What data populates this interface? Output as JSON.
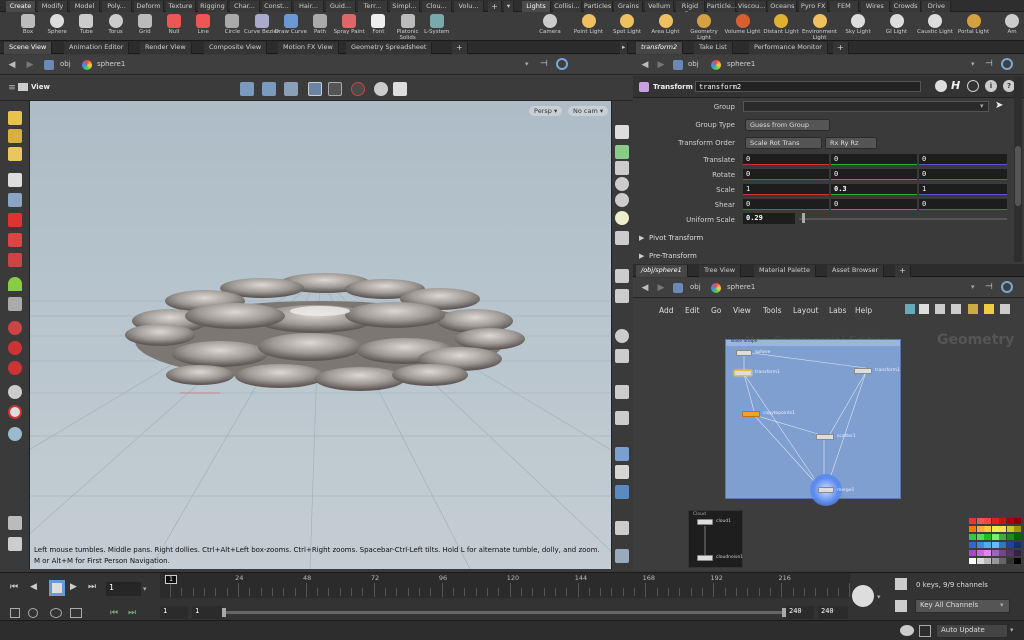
{
  "shelf_tabs_left": [
    "Create",
    "Modify",
    "Model",
    "Poly...",
    "Deform",
    "Texture",
    "Rigging",
    "Char...",
    "Const...",
    "Hair...",
    "Guid...",
    "Terr...",
    "Simpl...",
    "Clou...",
    "Volu..."
  ],
  "shelf_tabs_right": [
    "Lights a...",
    "Collisi...",
    "Particles",
    "Grains",
    "Vellum",
    "Rigid B...",
    "Particle...",
    "Viscou...",
    "Oceans",
    "Pyro FX",
    "FEM",
    "Wires",
    "Crowds",
    "Drive S..."
  ],
  "shelf_tools_left": [
    "Box",
    "Sphere",
    "Tube",
    "Torus",
    "Grid",
    "Null",
    "Line",
    "Circle",
    "Curve Bezier",
    "Draw Curve",
    "Path",
    "Spray Paint",
    "Font",
    "Platonic Solids",
    "L-System"
  ],
  "shelf_tools_right": [
    "Camera",
    "Point Light",
    "Spot Light",
    "Area Light",
    "Geometry Light",
    "Volume Light",
    "Distant Light",
    "Environment Light",
    "Sky Light",
    "GI Light",
    "Caustic Light",
    "Portal Light",
    "Am"
  ],
  "left_pane_tabs": [
    "Scene View",
    "Animation Editor",
    "Render View",
    "Composite View",
    "Motion FX View",
    "Geometry Spreadsheet"
  ],
  "right_top_tabs": [
    "transform2",
    "Take List",
    "Performance Monitor"
  ],
  "right_bottom_tabs": [
    "/obj/sphere1",
    "Tree View",
    "Material Palette",
    "Asset Browser"
  ],
  "path": {
    "obj": "obj",
    "node": "sphere1"
  },
  "viewport": {
    "title": "View",
    "persp": "Persp ▾",
    "cam": "No cam ▾",
    "help_line1": "Left mouse tumbles. Middle pans. Right dollies. Ctrl+Alt+Left box-zooms. Ctrl+Right zooms. Spacebar-Ctrl-Left tilts. Hold L for alternate tumble, dolly, and zoom.",
    "help_line2": "M or Alt+M for First Person Navigation."
  },
  "params": {
    "node_type": "Transform",
    "node_name": "transform2",
    "group_label": "Group",
    "group_value": "",
    "group_type_label": "Group Type",
    "group_type_value": "Guess from Group",
    "transform_order_label": "Transform Order",
    "transform_order_value": "Scale Rot Trans",
    "rot_order_value": "Rx Ry Rz",
    "translate_label": "Translate",
    "translate": [
      "0",
      "0",
      "0"
    ],
    "rotate_label": "Rotate",
    "rotate": [
      "0",
      "0",
      "0"
    ],
    "scale_label": "Scale",
    "scale": [
      "1",
      "0.3",
      "1"
    ],
    "shear_label": "Shear",
    "shear": [
      "0",
      "0",
      "0"
    ],
    "uniform_scale_label": "Uniform Scale",
    "uniform_scale": "0.29",
    "pivot_label": "Pivot Transform",
    "pretransform_label": "Pre-Transform"
  },
  "network": {
    "menu": [
      "Add",
      "Edit",
      "Go",
      "View",
      "Tools",
      "Layout",
      "Labs",
      "Help"
    ],
    "watermark": "Non-Commercial Edition",
    "context": "Geometry",
    "box_title": "Base Shape",
    "nodes": [
      "sphere",
      "transform1",
      "transform1",
      "copytopoints1",
      "scatter1",
      "merge1"
    ],
    "cloud_title": "Cloud",
    "cloud_nodes": [
      "cloud1",
      "cloudnoise1"
    ]
  },
  "timeline": {
    "ticks": [
      "1",
      "24",
      "48",
      "72",
      "96",
      "120",
      "144",
      "168",
      "192",
      "216"
    ],
    "frame": "1",
    "start": "1",
    "start2": "1",
    "end": "240",
    "end2": "240",
    "keys": "0 keys, 9/9 channels",
    "channels": "Key All Channels",
    "auto_update": "Auto Update"
  },
  "colors": {
    "accent": "#f0a030",
    "node_box": "#7f9fd0"
  }
}
